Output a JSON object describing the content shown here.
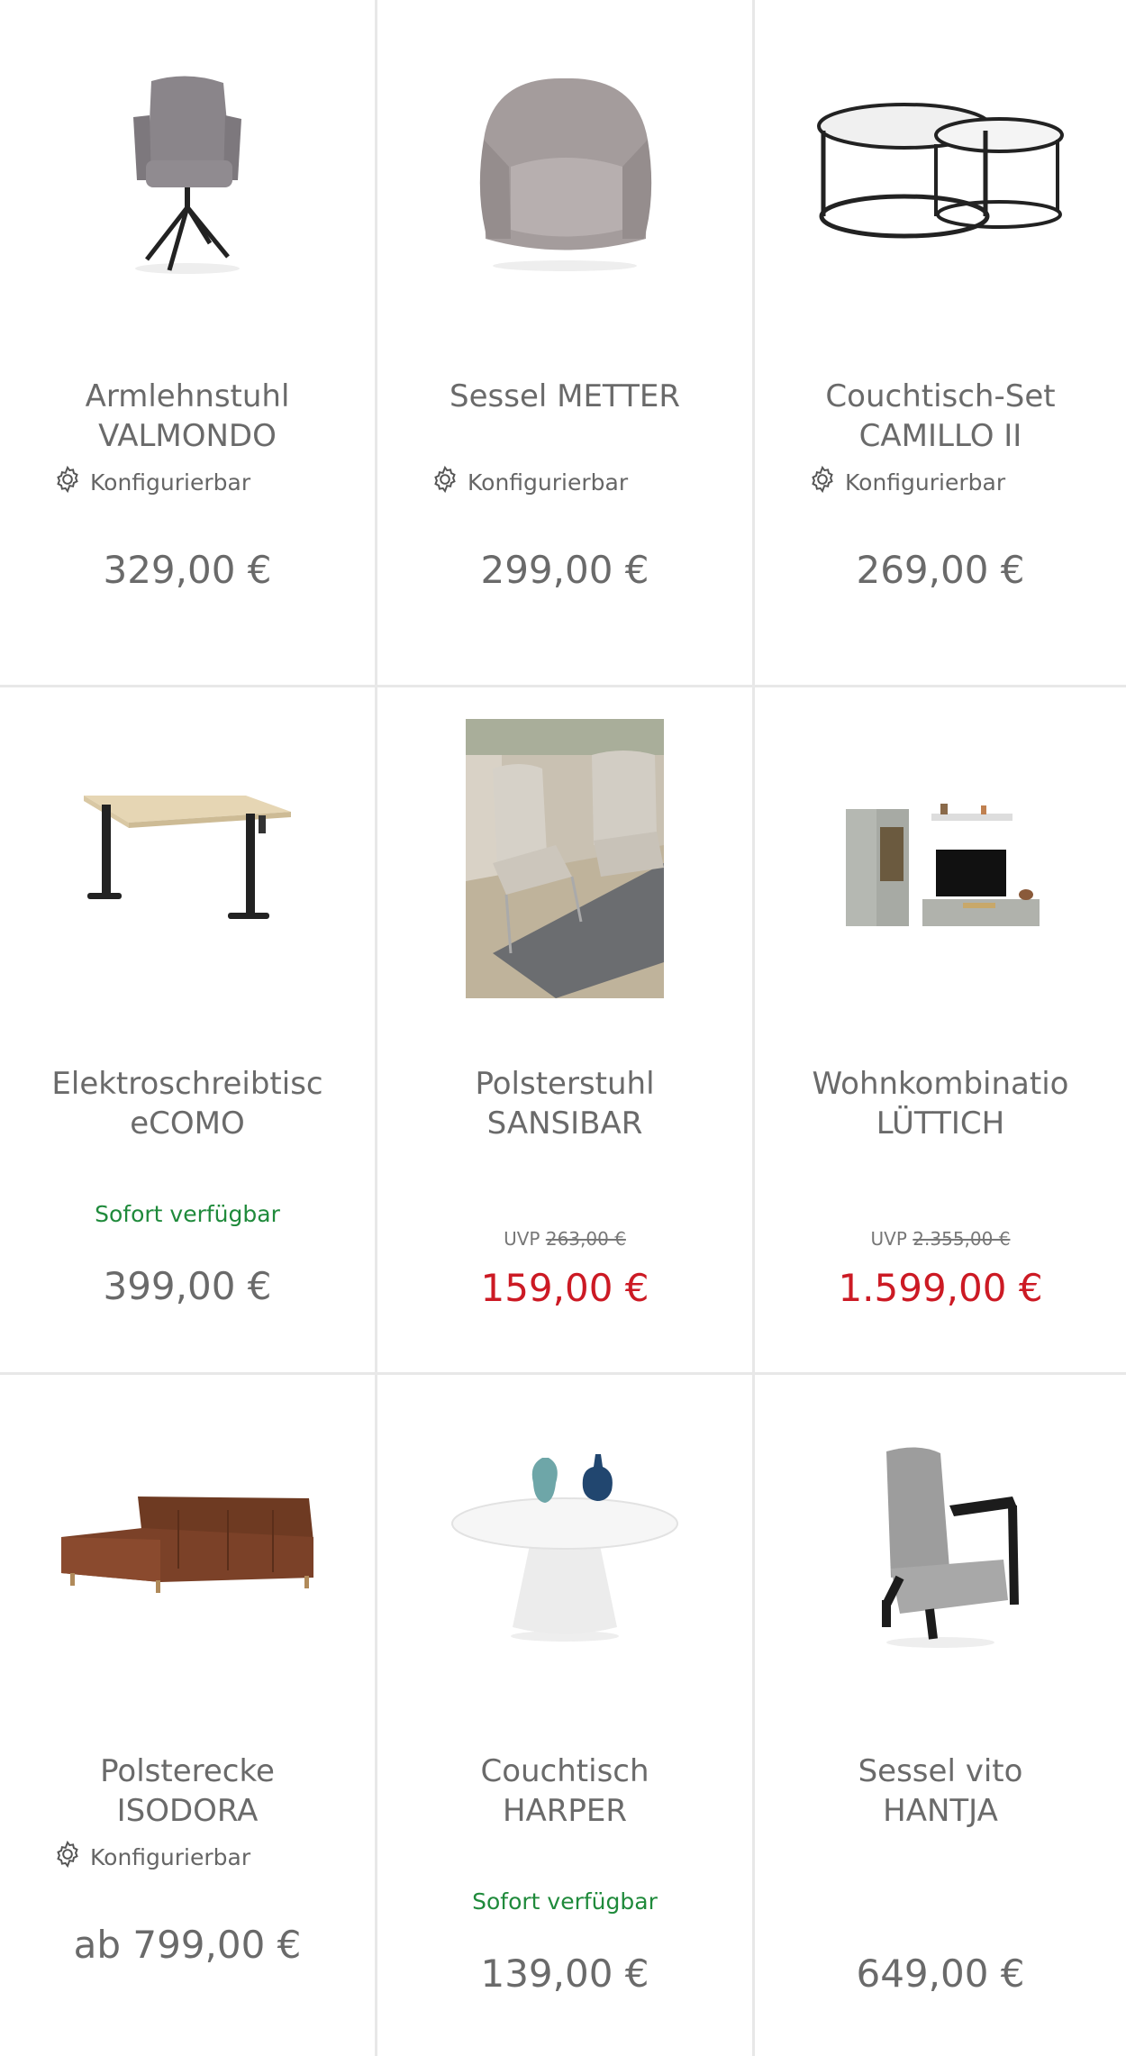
{
  "products": [
    {
      "line1": "Armlehnstuhl",
      "line2": "VALMONDO",
      "config": "Konfigurierbar",
      "price": "329,00 €"
    },
    {
      "line1": "Sessel METTER",
      "line2": "",
      "config": "Konfigurierbar",
      "price": "299,00 €"
    },
    {
      "line1": "Couchtisch-Set",
      "line2": "CAMILLO II",
      "config": "Konfigurierbar",
      "price": "269,00 €"
    },
    {
      "line1": "Elektroschreibtisc",
      "line2": "eCOMO",
      "availability": "Sofort verfügbar",
      "price": "399,00 €"
    },
    {
      "line1": "Polsterstuhl",
      "line2": "SANSIBAR",
      "uvp_label": "UVP",
      "uvp_price": "263,00 €",
      "price": "159,00 €"
    },
    {
      "line1": "Wohnkombinatio",
      "line2": "LÜTTICH",
      "uvp_label": "UVP",
      "uvp_price": "2.355,00 €",
      "price": "1.599,00 €"
    },
    {
      "line1": "Polsterecke",
      "line2": "ISODORA",
      "config": "Konfigurierbar",
      "price": "ab 799,00 €"
    },
    {
      "line1": "Couchtisch",
      "line2": "HARPER",
      "availability": "Sofort verfügbar",
      "price": "139,00 €"
    },
    {
      "line1": "Sessel vito",
      "line2": "HANTJA",
      "price": "649,00 €"
    }
  ],
  "colors": {
    "sale": "#cc1a24",
    "available": "#1f8a3b",
    "text": "#6a6a6a",
    "divider": "#e8e8e8"
  }
}
